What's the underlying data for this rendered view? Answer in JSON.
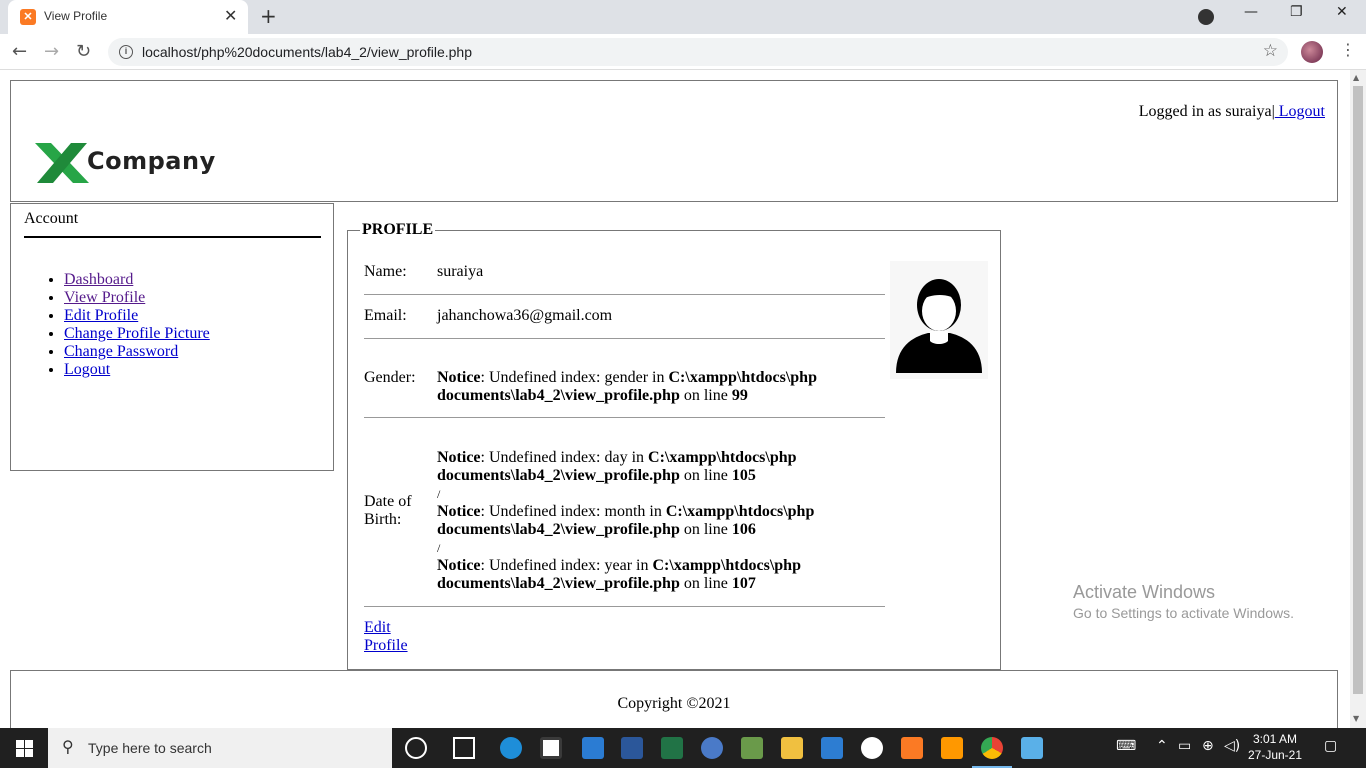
{
  "browser": {
    "tab_title": "View Profile",
    "tab_close": "✕",
    "new_tab": "+",
    "url": "localhost/php%20documents/lab4_2/view_profile.php",
    "back": "←",
    "forward": "→",
    "reload": "↻",
    "star": "☆",
    "info": "i",
    "minimize": "—",
    "restore": "❐",
    "close": "✕",
    "menu": "⋮"
  },
  "header": {
    "logo_text": "Company",
    "logged_in_prefix": "Logged in as suraiya|",
    "logout_link": " Logout"
  },
  "sidebar": {
    "title": "Account",
    "items": [
      {
        "label": "Dashboard"
      },
      {
        "label": "View Profile"
      },
      {
        "label": "Edit Profile"
      },
      {
        "label": "Change Profile Picture"
      },
      {
        "label": "Change Password"
      },
      {
        "label": "Logout"
      }
    ]
  },
  "profile": {
    "legend": "PROFILE",
    "name_label": "Name:",
    "name_value": "suraiya",
    "email_label": "Email:",
    "email_value": "jahanchowa36@gmail.com",
    "gender_label": "Gender:",
    "dob_label_1": "Date of",
    "dob_label_2": "Birth:",
    "notice_word": "Notice",
    "gender_notice": ": Undefined index: gender in ",
    "path_1": "C:\\xampp\\htdocs\\php",
    "path_2": "documents\\lab4_2\\view_profile.php",
    "on_line": " on line ",
    "gender_line": "99",
    "day_notice": ": Undefined index: day in ",
    "day_line": "105",
    "month_notice": ": Undefined index: month in ",
    "month_line": "106",
    "year_notice": ": Undefined index: year in ",
    "year_line": "107",
    "separator": "/",
    "edit_link_1": "Edit",
    "edit_link_2": "Profile"
  },
  "footer": {
    "copyright": "Copyright ©2021"
  },
  "watermark": {
    "line1": "Activate Windows",
    "line2": "Go to Settings to activate Windows."
  },
  "taskbar": {
    "search_placeholder": "Type here to search",
    "time": "3:01 AM",
    "date": "27-Jun-21"
  }
}
